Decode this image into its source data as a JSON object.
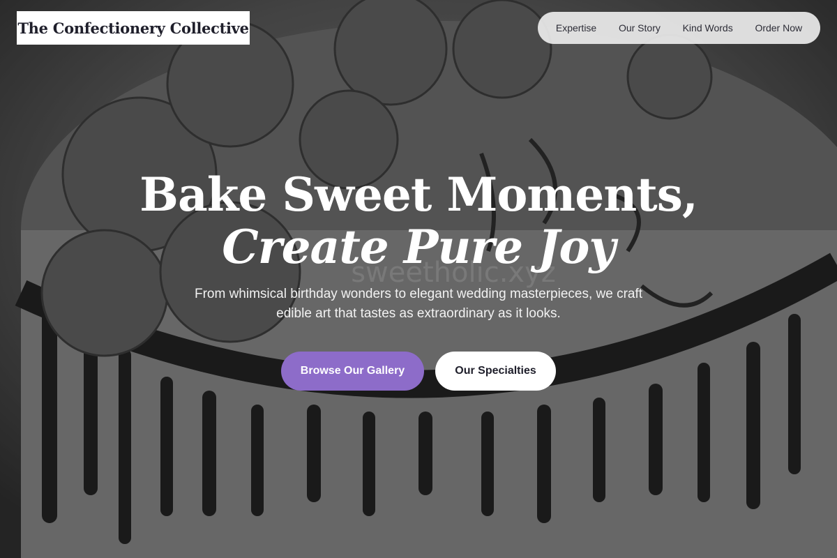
{
  "brand": {
    "name": "The Confectionery Collective"
  },
  "nav": {
    "items": [
      {
        "label": "Expertise"
      },
      {
        "label": "Our Story"
      },
      {
        "label": "Kind Words"
      },
      {
        "label": "Order Now"
      }
    ]
  },
  "hero": {
    "headline_line1": "Bake Sweet Moments,",
    "headline_line2": "Create Pure Joy",
    "subtitle": "From whimsical birthday wonders to elegant wedding masterpieces, we craft edible art that tastes as extraordinary as it looks.",
    "primary_cta": "Browse Our Gallery",
    "secondary_cta": "Our Specialties",
    "background_image": "grayscale-birthday-cake-photo",
    "watermark": "sweetholic.xyz"
  },
  "colors": {
    "accent": "#8d6cc9",
    "text_light": "#ffffff",
    "text_dark": "#1f1f2b"
  }
}
